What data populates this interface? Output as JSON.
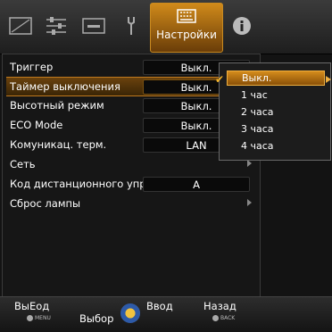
{
  "tabs": {
    "active_label": "Настройки",
    "icons": [
      "picture-icon",
      "sliders-icon",
      "screen-icon",
      "wrench-icon",
      "settings-grid-icon",
      "info-icon"
    ]
  },
  "menu": {
    "items": [
      {
        "label": "Триггер",
        "value": "Выкл."
      },
      {
        "label": "Таймер выключения",
        "value": "Выкл."
      },
      {
        "label": "Высотный режим",
        "value": "Выкл."
      },
      {
        "label": "ECO Mode",
        "value": "Выкл."
      },
      {
        "label": "Комуникац. терм.",
        "value": "LAN"
      },
      {
        "label": "Сеть",
        "value": ""
      },
      {
        "label": "Код дистанционного упр.",
        "value": "A"
      },
      {
        "label": "Сброс лампы",
        "value": ""
      }
    ],
    "selected_index": 1
  },
  "dropdown": {
    "options": [
      "Выкл.",
      "1 час",
      "2 часа",
      "3 часа",
      "4 часа"
    ],
    "selected": "Выкл."
  },
  "footer": {
    "exit_label": "ВыЕод",
    "exit_key": "MENU",
    "select_label": "Выбор",
    "enter_label": "Ввод",
    "back_label": "Назад",
    "back_key": "BACK"
  }
}
